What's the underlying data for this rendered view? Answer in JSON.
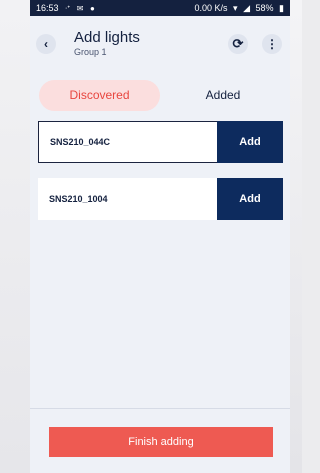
{
  "status_bar": {
    "time": "16:53",
    "left_icons": [
      "usb-icon",
      "mail-icon",
      "app-icon"
    ],
    "network_speed": "0.00 K/s",
    "battery": "58%"
  },
  "header": {
    "title": "Add lights",
    "subtitle": "Group 1",
    "back_icon": "chevron-left-icon",
    "refresh_icon": "refresh-icon",
    "more_icon": "more-vertical-icon"
  },
  "tabs": [
    {
      "label": "Discovered",
      "selected": true
    },
    {
      "label": "Added",
      "selected": false
    }
  ],
  "devices": [
    {
      "name": "SNS210_044C",
      "action_label": "Add"
    },
    {
      "name": "SNS210_1004",
      "action_label": "Add"
    }
  ],
  "footer": {
    "finish_label": "Finish adding"
  },
  "colors": {
    "navy": "#14213f",
    "add_button": "#0d2b5e",
    "accent_red": "#ee5a52",
    "tab_selected_bg": "#fbdede",
    "tab_selected_text": "#e8463f",
    "background": "#eef1f7"
  }
}
